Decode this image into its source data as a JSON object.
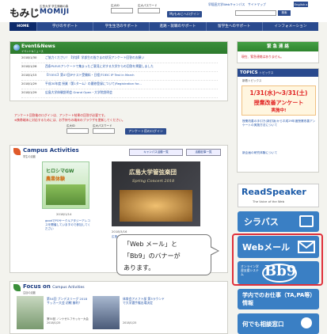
{
  "header": {
    "logo": "もみじ",
    "logo_sub": "広島大学 学生情報の森",
    "logo_en": "MOMIJI",
    "login_id_label": "広大ID",
    "login_pw_label": "広大パスワード",
    "login_button": "MyもみじへログインLogin",
    "top_links": "早稲田大学Webキャンパス　サイトマップ",
    "english_button": "English ▸",
    "search_button": "検索"
  },
  "nav": {
    "items": [
      "HOME",
      "学びのサポート",
      "学生生活のサポート",
      "進路・就職のサポート",
      "留学生へのサポート",
      "インフォメーション"
    ]
  },
  "event_news": {
    "title": "Event&News",
    "subtitle": "イベント&ニュース",
    "items": [
      {
        "date": "2018/1/30",
        "text": "ご協力ください！【学部】学部生の皆さまの状況アンケート回答のお願い"
      },
      {
        "date": "2018/1/26",
        "text": "西条PLEUSアンケートで集まったご意見に対する大学からの回答を掲載しました"
      },
      {
        "date": "2018/1/15",
        "text": "【TOEIC】第47回IPテスト受験料・日程/TOEIC IP Test in March"
      },
      {
        "date": "2018/1/29",
        "text": "平成30年度 授業（第1ターム）の履修登録について/Registration for..."
      },
      {
        "date": "2018/1/29",
        "text": "広島大学体験説明会 Grand Open・大学院説明会"
      }
    ]
  },
  "notice": {
    "line1": "アンケート回答後のログインは、アンケート結果の回答が必要です。",
    "line2": "※携帯端末に対応するためには、お手持ちの端末のブラウザを更新してください。"
  },
  "login_small": {
    "id_label": "広大ID",
    "pw_label": "広大パスワード",
    "button": "アンケート用のログイン"
  },
  "campus_activities": {
    "title": "Campus Activities",
    "subtitle": "学生の活動",
    "btn_list": "キャンパス活動一覧",
    "btn_rss": "活動記事一覧",
    "card1_title": "ヒロシマGW",
    "card1_sub": "農業体験",
    "card1_date": "2018/1/14",
    "card1_text": "goodでPOサークルアタジーアレコスを開催していますので参加してください",
    "card2_title": "広島大学管弦楽団",
    "card2_sub": "Spring Concert 2018",
    "card2_date": "2018/3/16",
    "card2_text": "広島大学管弦楽団の春の公演が予定されています"
  },
  "focus": {
    "title": "Focus on",
    "title_suffix": "Campus Activities",
    "subtitle": "注目の活動",
    "items": [
      {
        "title": "第54回 ブンデスリーグ 2018 サッカー大会 初戦 勝利！",
        "text": "第54回 ノンナゼルフサッカー大会 2018/1/25"
      },
      {
        "title": "体育会アメフト部 第3ラウンドで大学選手権出場決定",
        "text": "2018/1/25"
      }
    ]
  },
  "sidebar": {
    "emergency_title": "緊 急 連 絡",
    "emergency_text": "現在、緊急連絡はありません。",
    "topics_title": "TOPICS",
    "topics_sub": "トピックス",
    "topics_label": "新着トピックス",
    "red_banner_line1": "1/31(水)〜3/31(土)",
    "red_banner_line2": "授業改善アンケート",
    "red_banner_line3": "実施中!",
    "topic_text1": "授業改善の手引き(新訂版)から平成29年度授業改善アンケートの実施方法について",
    "topic_text2": "新企画の研究体験について",
    "readspeaker": "ReadSpeaker",
    "readspeaker_sub": "The Voice of the Web",
    "syllabus": "シラバス",
    "webmail": "Webメール",
    "bb9": "Bb9",
    "bb9_sub": "オンライン学習支援システム",
    "help": "学内でのお仕事（TA,PA等）情報",
    "consult": "何でも相談窓口"
  },
  "callout": {
    "line1": "「Web メール」と",
    "line2": "「Bb9」のバナーが",
    "line3": "あります。"
  },
  "colors": {
    "nav": "#2a4a8e",
    "event_green": "#2d7a2d",
    "syllabus_blue": "#3a7fc4",
    "highlight_red": "#e0303a"
  }
}
